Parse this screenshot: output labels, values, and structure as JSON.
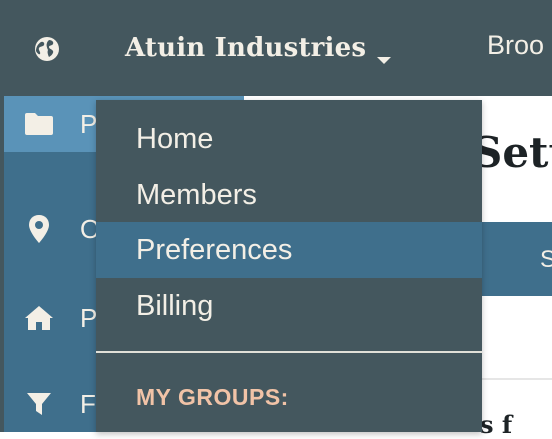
{
  "topbar": {
    "org_name": "Atuin Industries",
    "next_item_label": "Broo",
    "globe_icon": "globe-icon",
    "caret_icon": "chevron-down-icon"
  },
  "sidebar": {
    "items": [
      {
        "label": "P",
        "icon": "folder-icon",
        "active": true
      },
      {
        "label": "Ov",
        "icon": "map-pin-icon",
        "active": false
      },
      {
        "label": "P",
        "icon": "home-icon",
        "active": false
      },
      {
        "label": "Fi",
        "icon": "filter-icon",
        "active": false
      }
    ]
  },
  "dropdown": {
    "items": [
      {
        "label": "Home",
        "highlighted": false
      },
      {
        "label": "Members",
        "highlighted": false
      },
      {
        "label": "Preferences",
        "highlighted": true
      },
      {
        "label": "Billing",
        "highlighted": false
      }
    ],
    "section_header": "MY GROUPS:"
  },
  "main": {
    "title_fragment": "Sett",
    "strip_letter": "S",
    "bottom_fragment": "s f"
  },
  "colors": {
    "topbar_bg": "#44575e",
    "accent_blue": "#3f6f8c",
    "active_blue": "#5a93b8",
    "text_light": "#f3efe6",
    "section_header": "#f1c3a7"
  }
}
